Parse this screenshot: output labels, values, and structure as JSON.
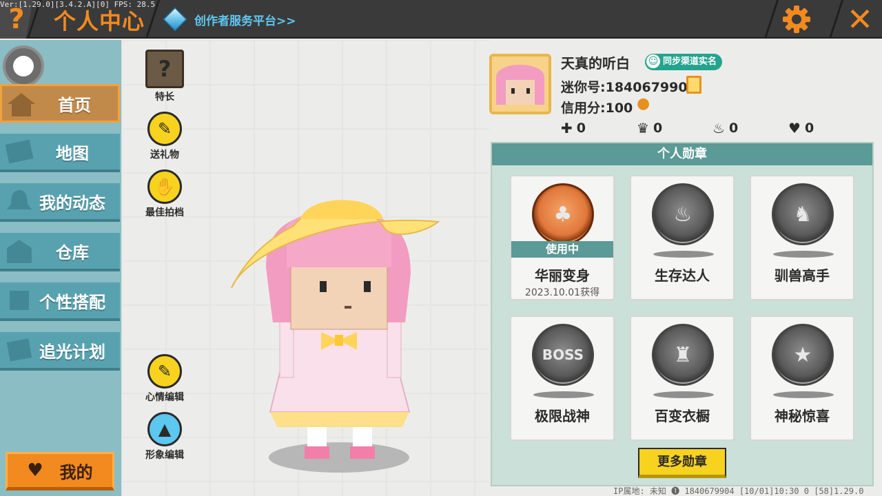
{
  "debug": "Ver:[1.29.0][3.4.2.A][0] FPS: 28.5",
  "header": {
    "help_glyph": "?",
    "title": "个人中心",
    "creator_label": "创作者服务平台>>",
    "close_glyph": "✕"
  },
  "sidebar": {
    "items": [
      {
        "label": "首页",
        "icon": "home-icon",
        "active": true
      },
      {
        "label": "地图",
        "icon": "map-icon",
        "active": false
      },
      {
        "label": "我的动态",
        "icon": "bell-icon",
        "active": false
      },
      {
        "label": "仓库",
        "icon": "warehouse-icon",
        "active": false
      },
      {
        "label": "个性搭配",
        "icon": "outfit-icon",
        "active": false
      },
      {
        "label": "追光计划",
        "icon": "spotlight-icon",
        "active": false
      }
    ],
    "me_label": "我的"
  },
  "actions": [
    {
      "label": "特长",
      "icon": "question-block-icon"
    },
    {
      "label": "送礼物",
      "icon": "gift-icon"
    },
    {
      "label": "最佳拍档",
      "icon": "handshake-icon"
    },
    {
      "label": "心情编辑",
      "icon": "edit-icon"
    },
    {
      "label": "形象编辑",
      "icon": "outfit-edit-icon"
    }
  ],
  "profile": {
    "name": "天真的听白",
    "sync_badge": "同步渠道实名",
    "mini_id": "迷你号:1840679904",
    "credit": "信用分:100",
    "stats": [
      {
        "icon": "add-friend-icon",
        "symbol": "✚",
        "value": "0"
      },
      {
        "icon": "trophy-icon",
        "symbol": "♛",
        "value": "0"
      },
      {
        "icon": "fire-icon",
        "symbol": "♨",
        "value": "0"
      },
      {
        "icon": "hearts-icon",
        "symbol": "♥",
        "value": "0"
      }
    ]
  },
  "badges": {
    "header": "个人勋章",
    "items": [
      {
        "name": "华丽变身",
        "glyph": "♣",
        "in_use": "使用中",
        "date": "2023.10.01获得",
        "active": true
      },
      {
        "name": "生存达人",
        "glyph": "♨",
        "in_use": "",
        "date": "",
        "active": false
      },
      {
        "name": "驯兽高手",
        "glyph": "♞",
        "in_use": "",
        "date": "",
        "active": false
      },
      {
        "name": "极限战神",
        "glyph": "BOSS",
        "in_use": "",
        "date": "",
        "active": false
      },
      {
        "name": "百变衣橱",
        "glyph": "♜",
        "in_use": "",
        "date": "",
        "active": false
      },
      {
        "name": "神秘惊喜",
        "glyph": "★",
        "in_use": "",
        "date": "",
        "active": false
      }
    ],
    "more_label": "更多勋章"
  },
  "footer": "IP属地: 未知 ❶   1840679904   [10/01]10:30 0   [58]1.29.0",
  "colors": {
    "accent_orange": "#f28a1f",
    "teal": "#5b9a96",
    "sidebar_blue": "#58a2b0",
    "yellow": "#f7d21f"
  }
}
